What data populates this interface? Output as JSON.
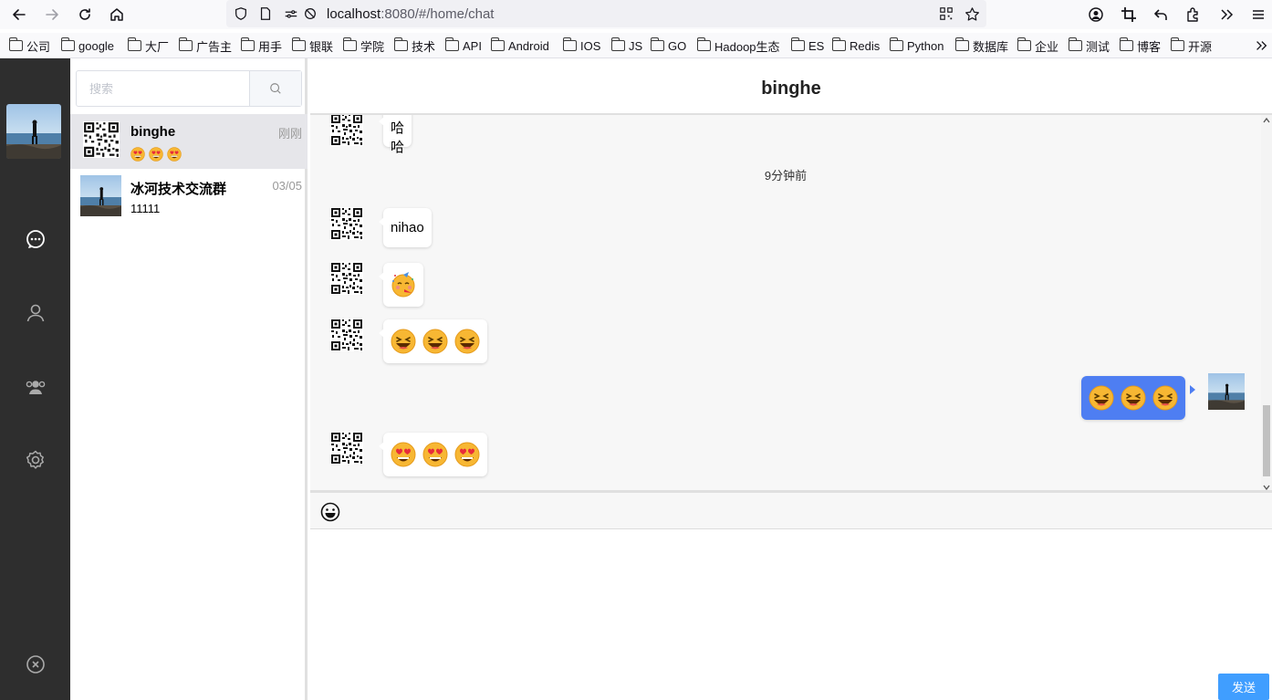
{
  "browser": {
    "url_host": "localhost",
    "url_rest": ":8080/#/home/chat"
  },
  "bookmarks": [
    "公司",
    "google",
    "大厂",
    "广告主",
    "用手",
    "银联",
    "学院",
    "技术",
    "API",
    "Android",
    "IOS",
    "JS",
    "GO",
    "Hadoop生态",
    "ES",
    "Redis",
    "Python",
    "数据库",
    "企业",
    "测试",
    "博客",
    "开源"
  ],
  "sidebar": {
    "search_placeholder": "搜索"
  },
  "sessions": [
    {
      "name": "binghe",
      "time": "刚刚",
      "preview_emojis": [
        "heart-eyes",
        "heart-eyes",
        "heart-eyes"
      ],
      "preview_text": ""
    },
    {
      "name": "冰河技术交流群",
      "time": "03/05",
      "preview_text": "11111"
    }
  ],
  "chat": {
    "title": "binghe",
    "timestamp": "9分钟前",
    "messages": [
      {
        "from": "other",
        "text": "哈哈哈"
      },
      {
        "from": "other",
        "text": "nihao"
      },
      {
        "from": "other",
        "emojis": [
          "party"
        ]
      },
      {
        "from": "other",
        "emojis": [
          "laugh",
          "laugh",
          "laugh"
        ]
      },
      {
        "from": "me",
        "emojis": [
          "laugh",
          "laugh",
          "laugh"
        ]
      },
      {
        "from": "other",
        "emojis": [
          "heart-eyes",
          "heart-eyes",
          "heart-eyes"
        ]
      }
    ]
  },
  "composer": {
    "send_label": "发送"
  },
  "colors": {
    "nav_bg": "#2e2e2e",
    "my_bubble": "#4e7ef2",
    "send_button": "#409eff"
  }
}
